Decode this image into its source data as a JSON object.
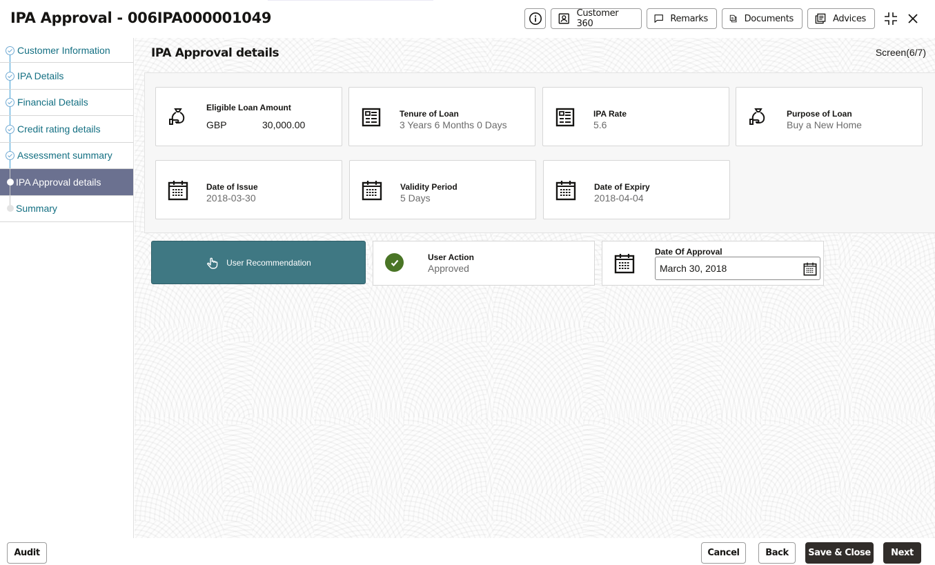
{
  "header": {
    "title": "IPA Approval - 006IPA000001049",
    "buttons": {
      "customer360": "Customer 360",
      "remarks": "Remarks",
      "documents": "Documents",
      "advices": "Advices"
    }
  },
  "sidebar": {
    "steps": [
      {
        "label": "Customer Information",
        "status": "completed"
      },
      {
        "label": "IPA Details",
        "status": "completed"
      },
      {
        "label": "Financial Details",
        "status": "completed"
      },
      {
        "label": "Credit rating details",
        "status": "completed"
      },
      {
        "label": "Assessment summary",
        "status": "completed"
      },
      {
        "label": "IPA Approval details",
        "status": "active"
      },
      {
        "label": "Summary",
        "status": "pending"
      }
    ]
  },
  "main": {
    "page_title": "IPA Approval details",
    "screen_counter": "Screen(6/7)",
    "cards": {
      "eligible_loan_amount": {
        "label": "Eligible Loan Amount",
        "currency": "GBP",
        "amount": "30,000.00",
        "icon": "money-bag-hand-icon"
      },
      "tenure_of_loan": {
        "label": "Tenure of Loan",
        "value": "3 Years 6 Months 0 Days",
        "icon": "document-list-icon"
      },
      "ipa_rate": {
        "label": "IPA Rate",
        "value": "5.6",
        "icon": "document-list-icon"
      },
      "purpose_of_loan": {
        "label": "Purpose of Loan",
        "value": "Buy a New Home",
        "icon": "money-bag-hand-icon"
      },
      "date_of_issue": {
        "label": "Date of Issue",
        "value": "2018-03-30",
        "icon": "calendar-icon"
      },
      "validity_period": {
        "label": "Validity Period",
        "value": "5 Days",
        "icon": "calendar-icon"
      },
      "date_of_expiry": {
        "label": "Date of Expiry",
        "value": "2018-04-04",
        "icon": "calendar-icon"
      }
    },
    "user_recommendation": {
      "label": "User Recommendation",
      "color": "#3f7883"
    },
    "user_action": {
      "label": "User Action",
      "value": "Approved",
      "status_color": "#4a7526"
    },
    "date_of_approval": {
      "label": "Date Of Approval",
      "value": "March 30, 2018"
    }
  },
  "footer": {
    "audit": "Audit",
    "cancel": "Cancel",
    "back": "Back",
    "save_close": "Save & Close",
    "next": "Next"
  }
}
